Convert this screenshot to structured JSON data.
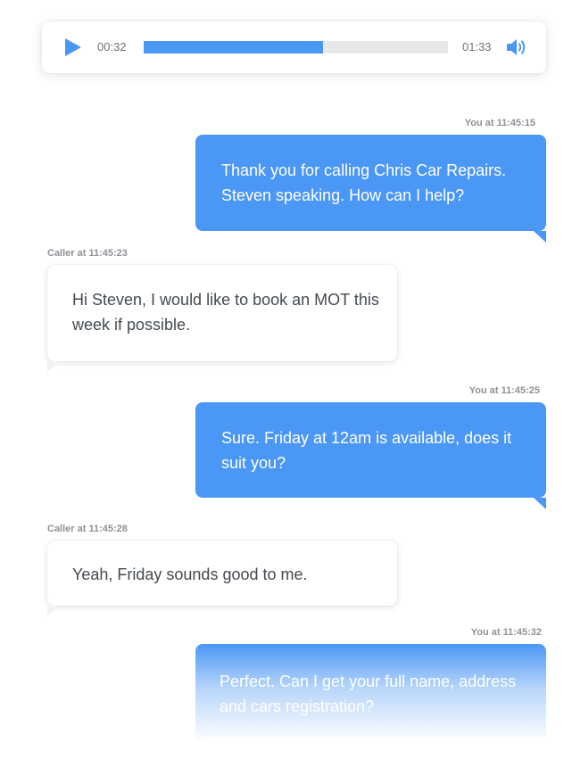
{
  "player": {
    "current_time": "00:32",
    "duration": "01:33",
    "progress": 0.59,
    "accent_color": "#4b97f5",
    "play_icon": "play-icon",
    "volume_icon": "volume-icon"
  },
  "messages": [
    {
      "sender": "you",
      "meta": "You at 11:45:15",
      "text": "Thank you for calling Chris Car Repairs. Steven speaking. How can I help?"
    },
    {
      "sender": "caller",
      "meta": "Caller at 11:45:23",
      "text": "Hi Steven, I would like to book an MOT this week if possible."
    },
    {
      "sender": "you",
      "meta": "You at 11:45:25",
      "text": "Sure. Friday at 12am is available, does it suit you?"
    },
    {
      "sender": "caller",
      "meta": "Caller at 11:45:28",
      "text": "Yeah, Friday sounds good to me."
    },
    {
      "sender": "you",
      "meta": "You at 11:45:32",
      "text": "Perfect. Can I get your full name, address and cars registration?"
    }
  ]
}
